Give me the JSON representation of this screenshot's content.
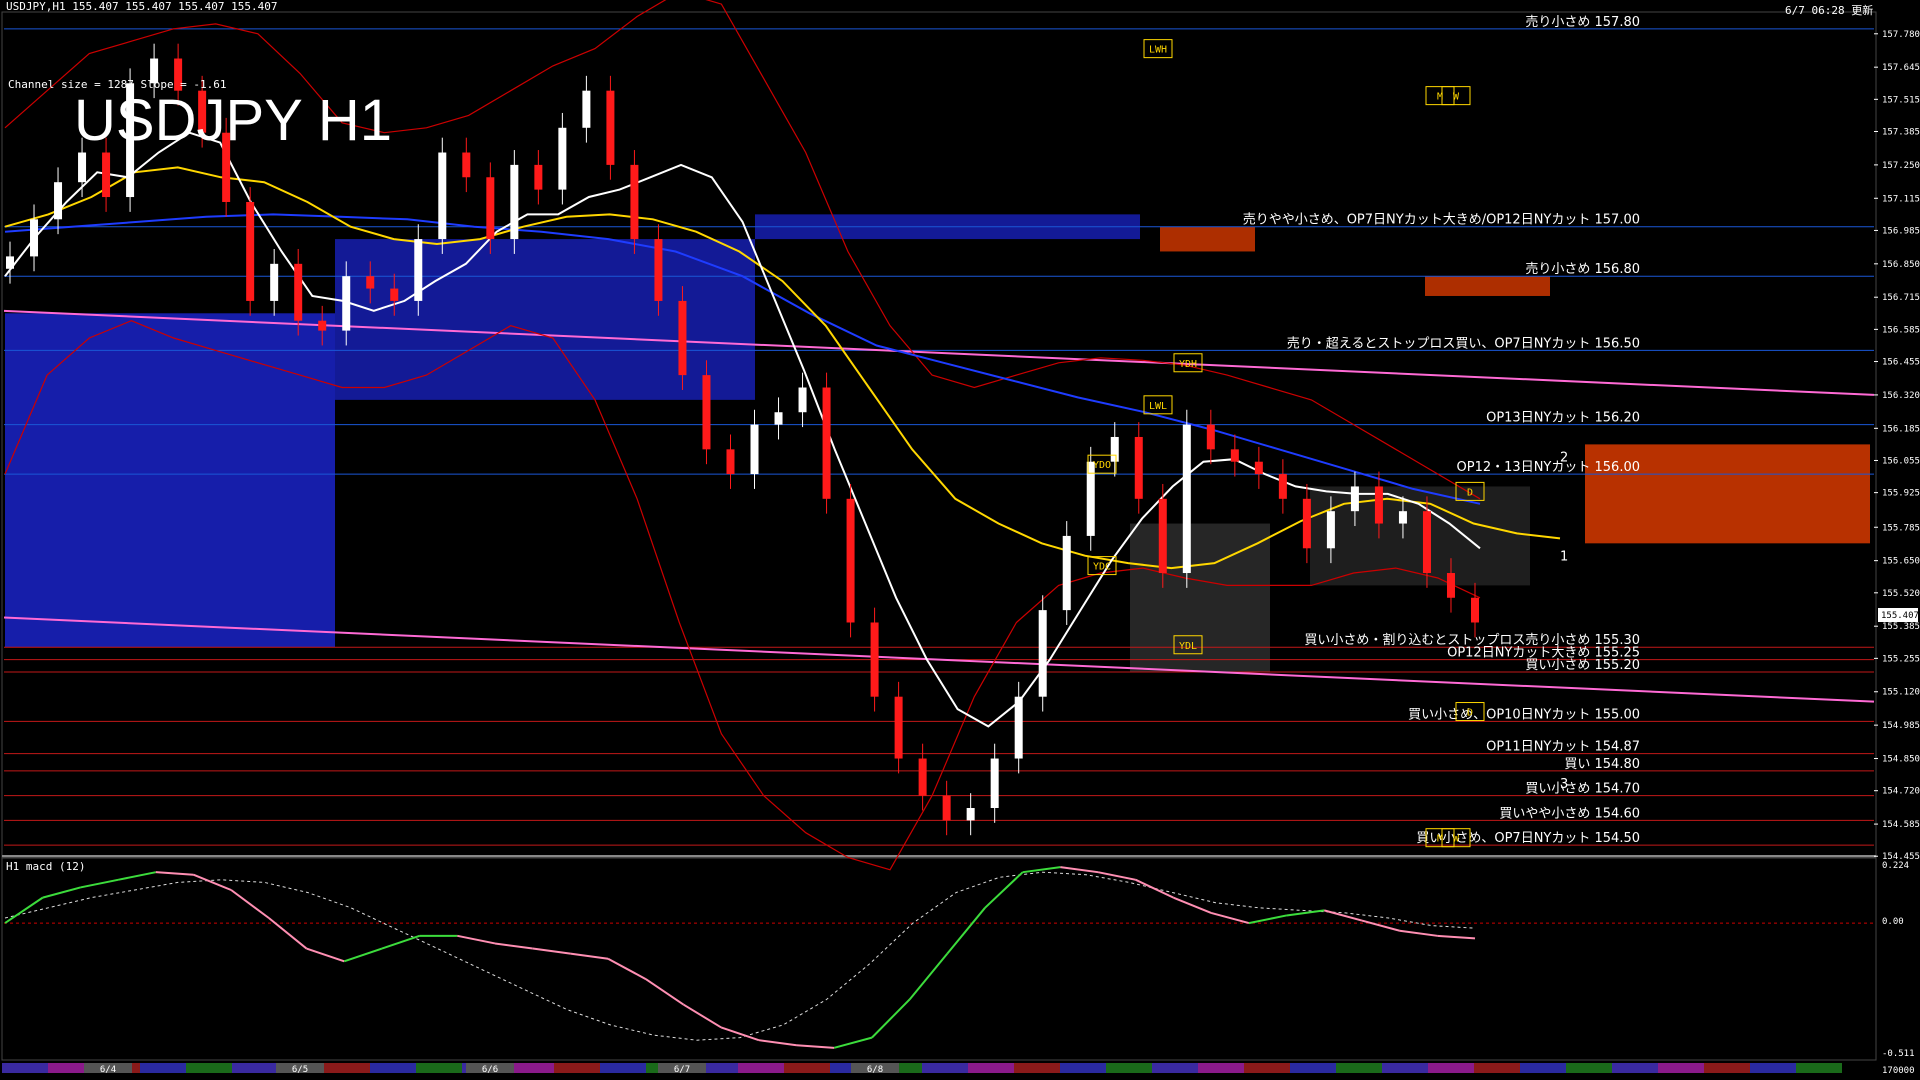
{
  "header": {
    "symbol_info": "USDJPY,H1  155.407 155.407 155.407 155.407",
    "channel_info": "Channel size = 1287 Slope = -1.61",
    "big_title": "USDJPY H1",
    "update_time": "6/7 06:28 更新"
  },
  "macd_panel": {
    "label": "H1  macd (12)",
    "ticks": [
      "0.224",
      "0.00",
      "-0.511"
    ],
    "bottom_label": "170000"
  },
  "colors": {
    "background": "#000000",
    "bull_candle": "#ffffff",
    "bear_candle": "#ff1a1a",
    "kumo_blue": "#1a23c8",
    "kumo_red": "#d83a00",
    "ma_white": "#ffffff",
    "ma_yellow": "#ffd700",
    "ma_blue": "#1e3cff",
    "bollinger_red": "#cc0000",
    "green_line": "#22c322",
    "channel_pink": "#ff6ad5",
    "level_blue": "#1a57d6",
    "level_red": "#c21818",
    "macd_green": "#3cdc3c",
    "macd_pink": "#ff8fb3"
  },
  "chart_data": {
    "type": "line",
    "symbol": "USDJPY",
    "timeframe": "H1",
    "ylim": [
      154.46,
      157.86
    ],
    "current_price": "155.407",
    "y_ticks": [
      "157.780",
      "157.645",
      "157.515",
      "157.385",
      "157.250",
      "157.115",
      "156.985",
      "156.850",
      "156.715",
      "156.585",
      "156.455",
      "156.320",
      "156.185",
      "156.055",
      "155.925",
      "155.785",
      "155.650",
      "155.520",
      "155.385",
      "155.255",
      "155.120",
      "154.985",
      "154.850",
      "154.720",
      "154.585",
      "154.455"
    ],
    "date_labels": [
      "6/4",
      "6/5",
      "6/6",
      "6/7",
      "6/8"
    ],
    "levels": [
      {
        "price": 157.8,
        "label": "売り小さめ 157.80",
        "side": "sell"
      },
      {
        "price": 157.0,
        "label": "売りやや小さめ、OP7日NYカット大きめ/OP12日NYカット 157.00",
        "side": "sell"
      },
      {
        "price": 156.8,
        "label": "売り小さめ 156.80",
        "side": "sell"
      },
      {
        "price": 156.5,
        "label": "売り・超えるとストップロス買い、OP7日NYカット 156.50",
        "side": "sell"
      },
      {
        "price": 156.2,
        "label": "OP13日NYカット 156.20",
        "side": "sell"
      },
      {
        "price": 156.0,
        "label": "OP12・13日NYカット 156.00",
        "side": "sell"
      },
      {
        "price": 155.3,
        "label": "買い小さめ・割り込むとストップロス売り小さめ 155.30",
        "side": "buy"
      },
      {
        "price": 155.25,
        "label": "OP12日NYカット大きめ 155.25",
        "side": "buy"
      },
      {
        "price": 155.2,
        "label": "買い小さめ 155.20",
        "side": "buy"
      },
      {
        "price": 155.0,
        "label": "買い小さめ、OP10日NYカット 155.00",
        "side": "buy"
      },
      {
        "price": 154.87,
        "label": "OP11日NYカット 154.87",
        "side": "buy"
      },
      {
        "price": 154.8,
        "label": "買い 154.80",
        "side": "buy"
      },
      {
        "price": 154.7,
        "label": "買い小さめ 154.70",
        "side": "buy"
      },
      {
        "price": 154.6,
        "label": "買いやや小さめ 154.60",
        "side": "buy"
      },
      {
        "price": 154.5,
        "label": "買い小さめ、OP7日NYカット 154.50",
        "side": "buy"
      }
    ],
    "markers": [
      {
        "label": "LWH",
        "price": 157.72
      },
      {
        "label": "LWL",
        "price": 156.28
      },
      {
        "label": "YDH",
        "price": 156.45
      },
      {
        "label": "YDO",
        "price": 156.04
      },
      {
        "label": "YDC",
        "price": 155.63
      },
      {
        "label": "YDL",
        "price": 155.31
      },
      {
        "label": "M",
        "price": 157.53
      },
      {
        "label": "W",
        "price": 157.53
      },
      {
        "label": "M",
        "price": 154.53
      },
      {
        "label": "W",
        "price": 154.53
      },
      {
        "label": "D",
        "price": 155.93
      },
      {
        "label": "D",
        "price": 155.04
      }
    ],
    "wave_labels": [
      "1",
      "2",
      "3"
    ],
    "series": [
      {
        "key": "close",
        "values": [
          156.88,
          157.03,
          157.18,
          157.3,
          157.12,
          157.58,
          157.68,
          157.55,
          157.38,
          157.1,
          156.7,
          156.85,
          156.62,
          156.58,
          156.8,
          156.75,
          156.7,
          156.95,
          157.3,
          157.2,
          156.95,
          157.25,
          157.15,
          157.4,
          157.55,
          157.25,
          156.95,
          156.7,
          156.4,
          156.1,
          156.0,
          156.2,
          156.25,
          156.35,
          155.9,
          155.4,
          155.1,
          154.85,
          154.7,
          154.6,
          154.65,
          154.85,
          155.1,
          155.45,
          155.75,
          156.05,
          156.15,
          155.9,
          155.6,
          156.2,
          156.1,
          156.05,
          156.0,
          155.9,
          155.7,
          155.85,
          155.95,
          155.8,
          155.85,
          155.6,
          155.5,
          155.4
        ]
      },
      {
        "key": "ma_white",
        "values": [
          156.8,
          156.96,
          157.1,
          157.22,
          157.2,
          157.3,
          157.38,
          157.34,
          157.1,
          156.9,
          156.72,
          156.7,
          156.66,
          156.7,
          156.78,
          156.85,
          156.98,
          157.05,
          157.05,
          157.12,
          157.15,
          157.2,
          157.25,
          157.2,
          157.02,
          156.72,
          156.42,
          156.1,
          155.8,
          155.5,
          155.25,
          155.05,
          154.98,
          155.08,
          155.25,
          155.45,
          155.65,
          155.82,
          155.95,
          156.05,
          156.06,
          156.0,
          155.95,
          155.93,
          155.92,
          155.92,
          155.88,
          155.8,
          155.7
        ]
      },
      {
        "key": "ma_yellow",
        "values": [
          157.0,
          157.05,
          157.12,
          157.22,
          157.24,
          157.2,
          157.18,
          157.1,
          157.0,
          156.95,
          156.93,
          156.95,
          157.0,
          157.04,
          157.05,
          157.03,
          156.98,
          156.9,
          156.78,
          156.6,
          156.35,
          156.1,
          155.9,
          155.8,
          155.72,
          155.67,
          155.64,
          155.62,
          155.64,
          155.72,
          155.81,
          155.88,
          155.9,
          155.88,
          155.8,
          155.76,
          155.74
        ]
      },
      {
        "key": "ma_blue",
        "values": [
          156.98,
          157.0,
          157.02,
          157.04,
          157.05,
          157.04,
          157.03,
          157.0,
          156.98,
          156.95,
          156.9,
          156.8,
          156.65,
          156.52,
          156.45,
          156.38,
          156.31,
          156.25,
          156.18,
          156.1,
          156.02,
          155.94,
          155.88
        ]
      },
      {
        "key": "bb_upper",
        "values": [
          157.4,
          157.55,
          157.7,
          157.75,
          157.8,
          157.82,
          157.78,
          157.62,
          157.42,
          157.38,
          157.4,
          157.45,
          157.55,
          157.65,
          157.72,
          157.85,
          157.95,
          157.9,
          157.6,
          157.3,
          156.9,
          156.6,
          156.4,
          156.35,
          156.4,
          156.45,
          156.47,
          156.46,
          156.44,
          156.4,
          156.35,
          156.3,
          156.2,
          156.1,
          156.0,
          155.9
        ]
      },
      {
        "key": "bb_lower",
        "values": [
          156.0,
          156.4,
          156.55,
          156.62,
          156.55,
          156.5,
          156.45,
          156.4,
          156.35,
          156.35,
          156.4,
          156.5,
          156.6,
          156.55,
          156.3,
          155.9,
          155.4,
          154.95,
          154.7,
          154.55,
          154.45,
          154.4,
          154.7,
          155.1,
          155.4,
          155.55,
          155.6,
          155.62,
          155.58,
          155.55,
          155.55,
          155.55,
          155.6,
          155.62,
          155.58,
          155.5
        ]
      },
      {
        "key": "macd_signal",
        "values": [
          0.02,
          0.06,
          0.1,
          0.13,
          0.16,
          0.17,
          0.16,
          0.12,
          0.06,
          -0.02,
          -0.1,
          -0.18,
          -0.26,
          -0.34,
          -0.4,
          -0.44,
          -0.46,
          -0.45,
          -0.4,
          -0.3,
          -0.16,
          0.0,
          0.12,
          0.18,
          0.2,
          0.19,
          0.16,
          0.12,
          0.08,
          0.06,
          0.05,
          0.04,
          0.02,
          -0.01,
          -0.02
        ]
      },
      {
        "key": "macd_main",
        "values": [
          0.0,
          0.1,
          0.14,
          0.17,
          0.2,
          0.19,
          0.13,
          0.02,
          -0.1,
          -0.15,
          -0.1,
          -0.05,
          -0.05,
          -0.08,
          -0.1,
          -0.12,
          -0.14,
          -0.22,
          -0.32,
          -0.41,
          -0.46,
          -0.48,
          -0.49,
          -0.45,
          -0.3,
          -0.12,
          0.06,
          0.2,
          0.22,
          0.2,
          0.17,
          0.1,
          0.04,
          0.0,
          0.03,
          0.05,
          0.01,
          -0.03,
          -0.05,
          -0.06
        ]
      }
    ]
  }
}
